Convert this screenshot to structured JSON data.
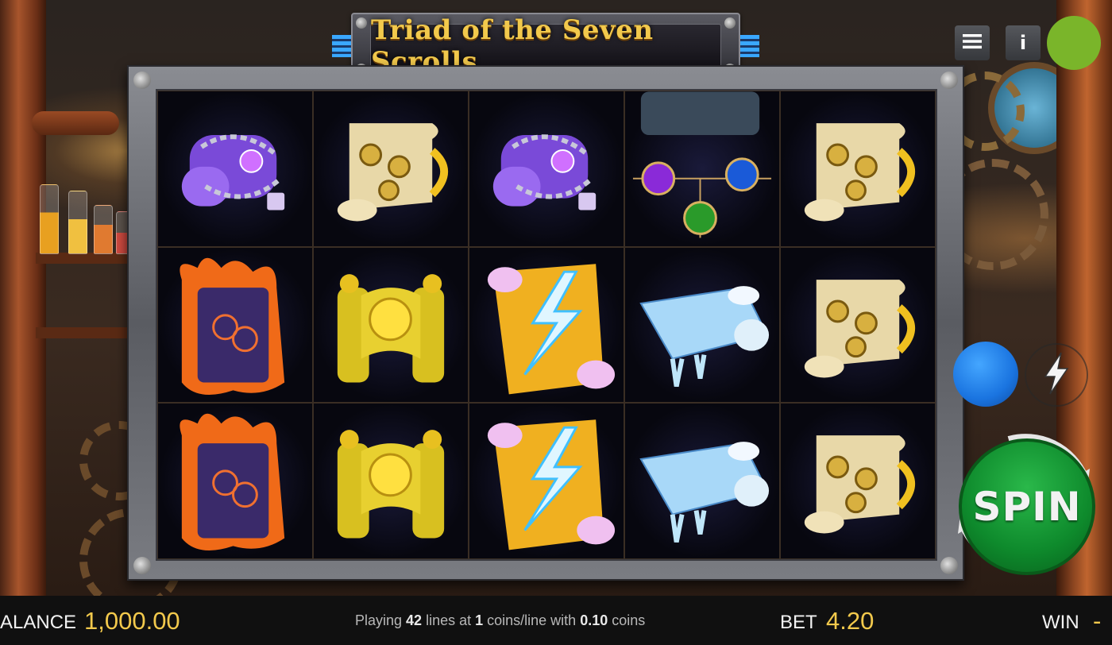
{
  "game": {
    "title": "Triad of the Seven Scrolls"
  },
  "controls": {
    "menu_icon": "hamburger-menu-icon",
    "info_label": "i",
    "spin_label": "SPIN",
    "turbo_icon": "lightning-icon"
  },
  "reels": [
    [
      "chained-scroll",
      "clock-scroll",
      "chained-scroll",
      "orb-medallion",
      "clock-scroll"
    ],
    [
      "fire-scroll",
      "golden-sun-scroll",
      "lightning-scroll",
      "ice-scroll",
      "clock-scroll"
    ],
    [
      "fire-scroll",
      "golden-sun-scroll",
      "lightning-scroll",
      "ice-scroll",
      "clock-scroll"
    ]
  ],
  "bottom_bar": {
    "balance_label": "ALANCE",
    "balance_value": "1,000.00",
    "info": {
      "prefix": "Playing ",
      "lines": "42",
      "lines_text": " lines at ",
      "coins": "1",
      "coins_text": " coins/line with ",
      "coin_value": "0.10",
      "suffix": " coins"
    },
    "bet_label": "BET",
    "bet_value": "4.20",
    "win_label": "WIN",
    "win_value": "-"
  },
  "colors": {
    "accent_gold": "#f2c94c",
    "spin_green": "#0e8a2c",
    "status_green": "#7ab52a",
    "autoplay_blue": "#1a74e0"
  }
}
